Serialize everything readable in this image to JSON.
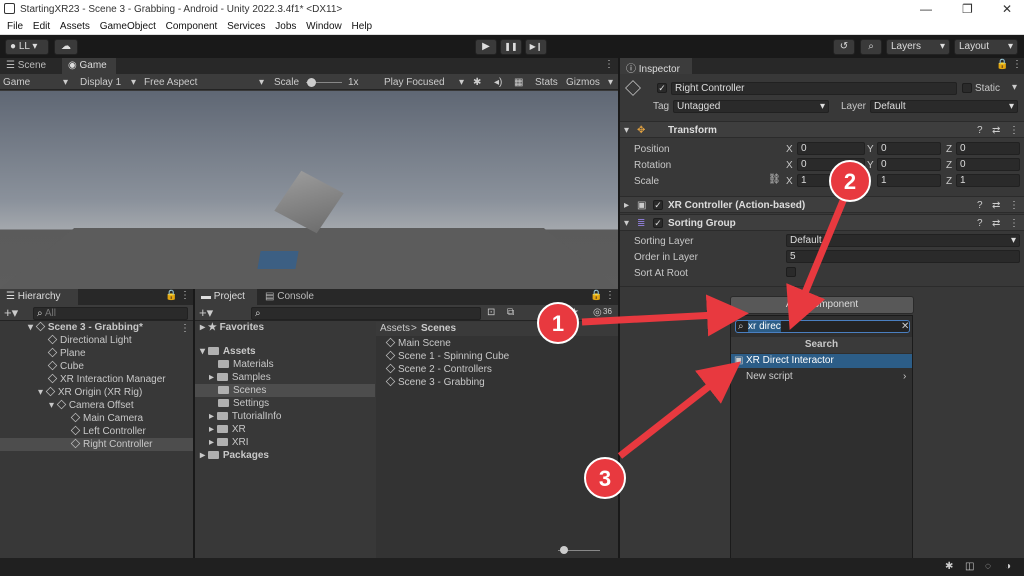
{
  "window": {
    "title": "StartingXR23 - Scene 3 - Grabbing - Android - Unity 2022.3.4f1* <DX11>",
    "min": "—",
    "max": "❐",
    "close": "✕"
  },
  "menu": [
    "File",
    "Edit",
    "Assets",
    "GameObject",
    "Component",
    "Services",
    "Jobs",
    "Window",
    "Help"
  ],
  "toolbar": {
    "account": "LL",
    "layers": "Layers",
    "layout": "Layout",
    "play": "▶",
    "pause": "❚❚",
    "step": "▶❙",
    "history": "↺",
    "search": "⌕"
  },
  "scene_tabs": {
    "scene": "Scene",
    "game": "Game"
  },
  "game_bar": {
    "mode": "Game",
    "display": "Display 1",
    "aspect": "Free Aspect",
    "scale_label": "Scale",
    "scale_value": "1x",
    "play_focused": "Play Focused",
    "stats": "Stats",
    "gizmos": "Gizmos"
  },
  "hierarchy": {
    "tab": "Hierarchy",
    "search_placeholder": "All",
    "items": [
      {
        "label": "Scene 3 - Grabbing*",
        "depth": 0
      },
      {
        "label": "Directional Light",
        "depth": 1
      },
      {
        "label": "Plane",
        "depth": 1
      },
      {
        "label": "Cube",
        "depth": 1
      },
      {
        "label": "XR Interaction Manager",
        "depth": 1
      },
      {
        "label": "XR Origin (XR Rig)",
        "depth": 1
      },
      {
        "label": "Camera Offset",
        "depth": 2
      },
      {
        "label": "Main Camera",
        "depth": 3
      },
      {
        "label": "Left Controller",
        "depth": 3
      },
      {
        "label": "Right Controller",
        "depth": 3
      }
    ]
  },
  "project": {
    "tab_project": "Project",
    "tab_console": "Console",
    "favorites": "Favorites",
    "assets": "Assets",
    "folders": [
      "Materials",
      "Samples",
      "Scenes",
      "Settings",
      "TutorialInfo",
      "XR",
      "XRI"
    ],
    "packages": "Packages",
    "breadcrumb_root": "Assets",
    "breadcrumb_sep": ">",
    "breadcrumb_leaf": "Scenes",
    "files": [
      "Main Scene",
      "Scene 1 - Spinning Cube",
      "Scene 2 - Controllers",
      "Scene 3 - Grabbing"
    ],
    "badge": "36"
  },
  "inspector": {
    "tab": "Inspector",
    "object_name": "Right Controller",
    "static": "Static",
    "tag_label": "Tag",
    "tag_value": "Untagged",
    "layer_label": "Layer",
    "layer_value": "Default",
    "transform": {
      "title": "Transform",
      "position": "Position",
      "rotation": "Rotation",
      "scale": "Scale",
      "pos": [
        "0",
        "0",
        "0"
      ],
      "rot": [
        "0",
        "0",
        "0"
      ],
      "scl": [
        "1",
        "1",
        "1"
      ],
      "x": "X",
      "y": "Y",
      "z": "Z"
    },
    "xr_controller": "XR Controller (Action-based)",
    "sorting": {
      "title": "Sorting Group",
      "layer_label": "Sorting Layer",
      "layer_value": "Default",
      "order_label": "Order in Layer",
      "order_value": "5",
      "root_label": "Sort At Root"
    },
    "add_component": "Add Component"
  },
  "popup": {
    "search_value": "xr direc",
    "header": "Search",
    "items": [
      "XR Direct Interactor",
      "New script"
    ]
  },
  "annotations": [
    "1",
    "2",
    "3"
  ],
  "colors": {
    "accent": "#2c5d87",
    "annotation": "#e8393f",
    "play_bg": "#3a3a3a"
  }
}
